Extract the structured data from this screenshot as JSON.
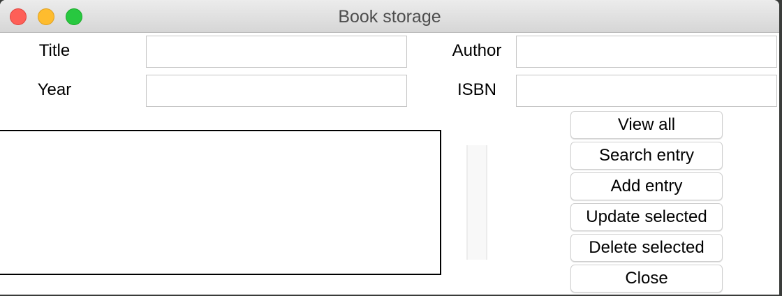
{
  "window": {
    "title": "Book storage"
  },
  "form": {
    "title_label": "Title",
    "author_label": "Author",
    "year_label": "Year",
    "isbn_label": "ISBN",
    "title_value": "",
    "author_value": "",
    "year_value": "",
    "isbn_value": ""
  },
  "list": {
    "items": []
  },
  "buttons": {
    "view_all": "View all",
    "search_entry": "Search entry",
    "add_entry": "Add entry",
    "update_selected": "Update selected",
    "delete_selected": "Delete selected",
    "close": "Close"
  },
  "colors": {
    "close_light": "#fe5f57",
    "minimize_light": "#febc2e",
    "maximize_light": "#28c840"
  }
}
